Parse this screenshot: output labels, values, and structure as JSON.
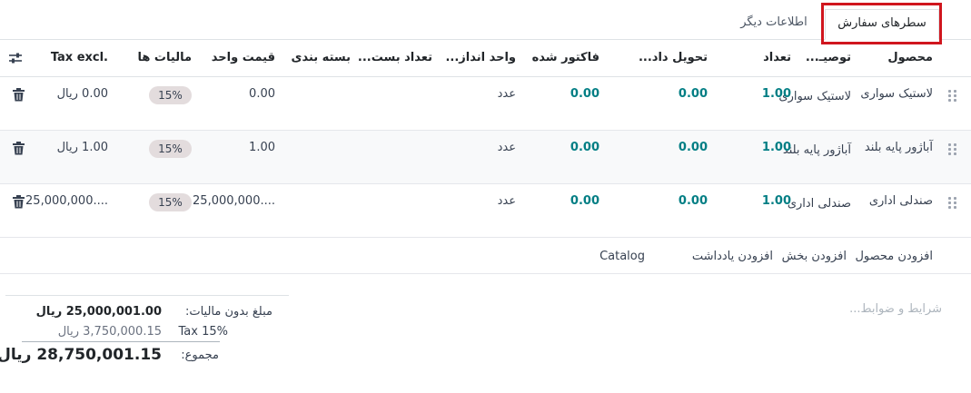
{
  "tabs": {
    "order_lines": "سطرهای سفارش",
    "other_info": "اطلاعات دیگر"
  },
  "columns": {
    "product": "محصول",
    "description": "توصیـ...",
    "quantity": "تعداد",
    "delivered": "تحویل داد...",
    "invoiced": "فاکتور شده",
    "uom": "واحد انداز...",
    "package_qty": "تعداد بست...",
    "packaging": "بسته بندی",
    "unit_price": "قیمت واحد",
    "taxes": "مالیات ها",
    "tax_excl": "Tax excl."
  },
  "rows": [
    {
      "product": "لاستیک سواری",
      "description": "لاستیک سواری",
      "quantity": "1.00",
      "delivered": "0.00",
      "invoiced": "0.00",
      "uom": "عدد",
      "unit_price": "0.00",
      "tax": "15%",
      "subtotal": "0.00 ریال"
    },
    {
      "product": "آباژور پایه بلند",
      "description": "آباژور پایه بلند",
      "quantity": "1.00",
      "delivered": "0.00",
      "invoiced": "0.00",
      "uom": "عدد",
      "unit_price": "1.00",
      "tax": "15%",
      "subtotal": "1.00 ریال"
    },
    {
      "product": "صندلی اداری",
      "description": "صندلی اداری",
      "quantity": "1.00",
      "delivered": "0.00",
      "invoiced": "0.00",
      "uom": "عدد",
      "unit_price": "25,000,000....",
      "tax": "15%",
      "subtotal": "25,000,000...."
    }
  ],
  "add_actions": {
    "add_product": "افزودن محصول",
    "add_section": "افزودن بخش",
    "add_note": "افزودن یادداشت",
    "catalog": "Catalog"
  },
  "terms_placeholder": "شرایط و ضوابط...",
  "totals": {
    "untaxed_label": "مبلغ بدون مالیات:",
    "untaxed_value": "25,000,001.00 ریال",
    "tax_label": "Tax 15%",
    "tax_value": "3,750,000.15 ریال",
    "total_label": "مجموع:",
    "total_value": "28,750,001.15 ریال"
  },
  "colors": {
    "accent": "#017e84",
    "highlight": "#d0161e",
    "badge_bg": "#e3dcdd"
  },
  "icons": {
    "column_settings": "sliders-icon",
    "drag_handle": "drag-handle-icon",
    "delete": "trash-icon"
  }
}
